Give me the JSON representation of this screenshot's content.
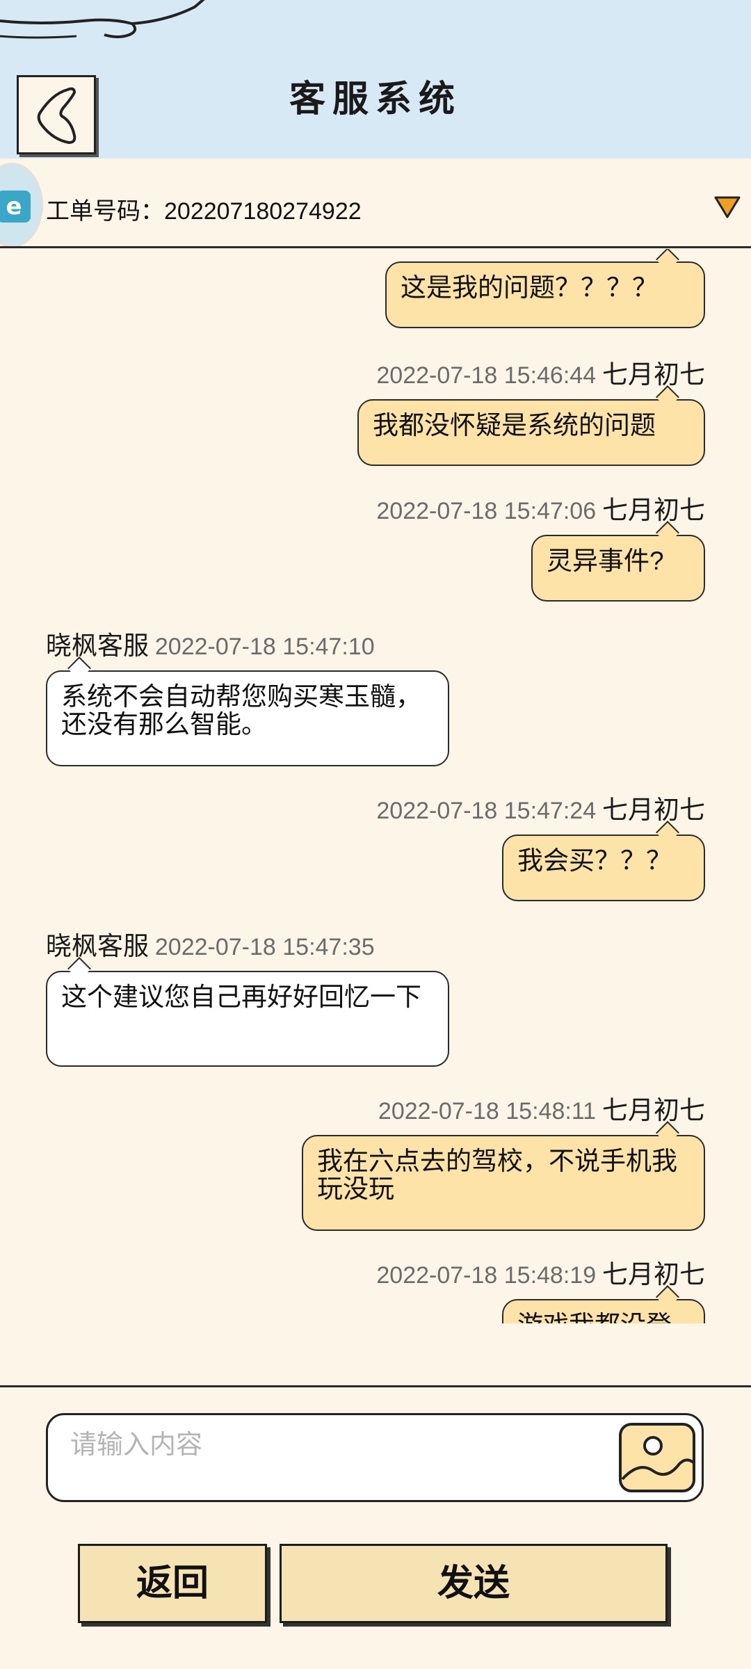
{
  "header": {
    "title": "客服系统"
  },
  "ticket": {
    "label": "工单号码：",
    "number": "202207180274922",
    "app_icon_text": "e"
  },
  "messages": [
    {
      "sender": "user",
      "text": "这是我的问题？？？？"
    },
    {
      "sender": "user",
      "name": "七月初七",
      "time": "2022-07-18 15:46:44",
      "text": "我都没怀疑是系统的问题"
    },
    {
      "sender": "user",
      "name": "七月初七",
      "time": "2022-07-18 15:47:06",
      "text": "灵异事件?"
    },
    {
      "sender": "agent",
      "name": "晓枫客服",
      "time": "2022-07-18 15:47:10",
      "text": "系统不会自动帮您购买寒玉髓，还没有那么智能。"
    },
    {
      "sender": "user",
      "name": "七月初七",
      "time": "2022-07-18 15:47:24",
      "text": "我会买？？？"
    },
    {
      "sender": "agent",
      "name": "晓枫客服",
      "time": "2022-07-18 15:47:35",
      "text": "这个建议您自己再好好回忆一下"
    },
    {
      "sender": "user",
      "name": "七月初七",
      "time": "2022-07-18 15:48:11",
      "text": "我在六点去的驾校，不说手机我玩没玩"
    },
    {
      "sender": "user",
      "name": "七月初七",
      "time": "2022-07-18 15:48:19",
      "text": "游戏我都没登"
    }
  ],
  "input": {
    "placeholder": "请输入内容",
    "value": ""
  },
  "buttons": {
    "back_label": "返回",
    "send_label": "发送"
  },
  "colors": {
    "header_bg": "#d8e9f6",
    "page_bg": "#fdf6e8",
    "user_bubble": "#fde3a8",
    "agent_bubble": "#ffffff",
    "button_bg": "#f6e3b3",
    "dropdown": "#f0a020"
  },
  "icons": {
    "back": "back-chevron-icon",
    "dropdown": "triangle-down-icon",
    "image": "image-upload-icon"
  }
}
